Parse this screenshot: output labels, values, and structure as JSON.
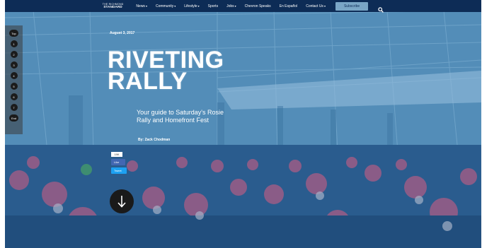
{
  "nav": {
    "logo_line1": "THE RICHMOND",
    "logo_line2": "STANDARD",
    "items": [
      {
        "label": "News",
        "caret": true
      },
      {
        "label": "Community",
        "caret": true
      },
      {
        "label": "Lifestyle",
        "caret": true
      },
      {
        "label": "Sports",
        "caret": false
      },
      {
        "label": "Jobs",
        "caret": true
      },
      {
        "label": "Chevron Speaks",
        "caret": false
      },
      {
        "label": "En Español",
        "caret": false
      },
      {
        "label": "Contact Us",
        "caret": true
      }
    ],
    "subscribe_label": "Subscribe",
    "search_icon": "search-icon"
  },
  "rail": {
    "items": [
      "Top",
      "1",
      "2",
      "3",
      "4",
      "5",
      "6",
      "7",
      "End"
    ]
  },
  "hero": {
    "date": "August 3, 2017",
    "title_line1": "RIVETING",
    "title_line2": "RALLY",
    "subtitle": "Your guide to Saturday's Rosie Rally and Homefront Fest",
    "byline": "By: Zack Chodman"
  },
  "social": {
    "share_count": "19K",
    "like_label": "Like",
    "tweet_label": "Tweet"
  },
  "colors": {
    "nav_bg": "#0d2c56",
    "overlay": "#2676b6",
    "subscribe_bg": "#7aa6c6"
  }
}
